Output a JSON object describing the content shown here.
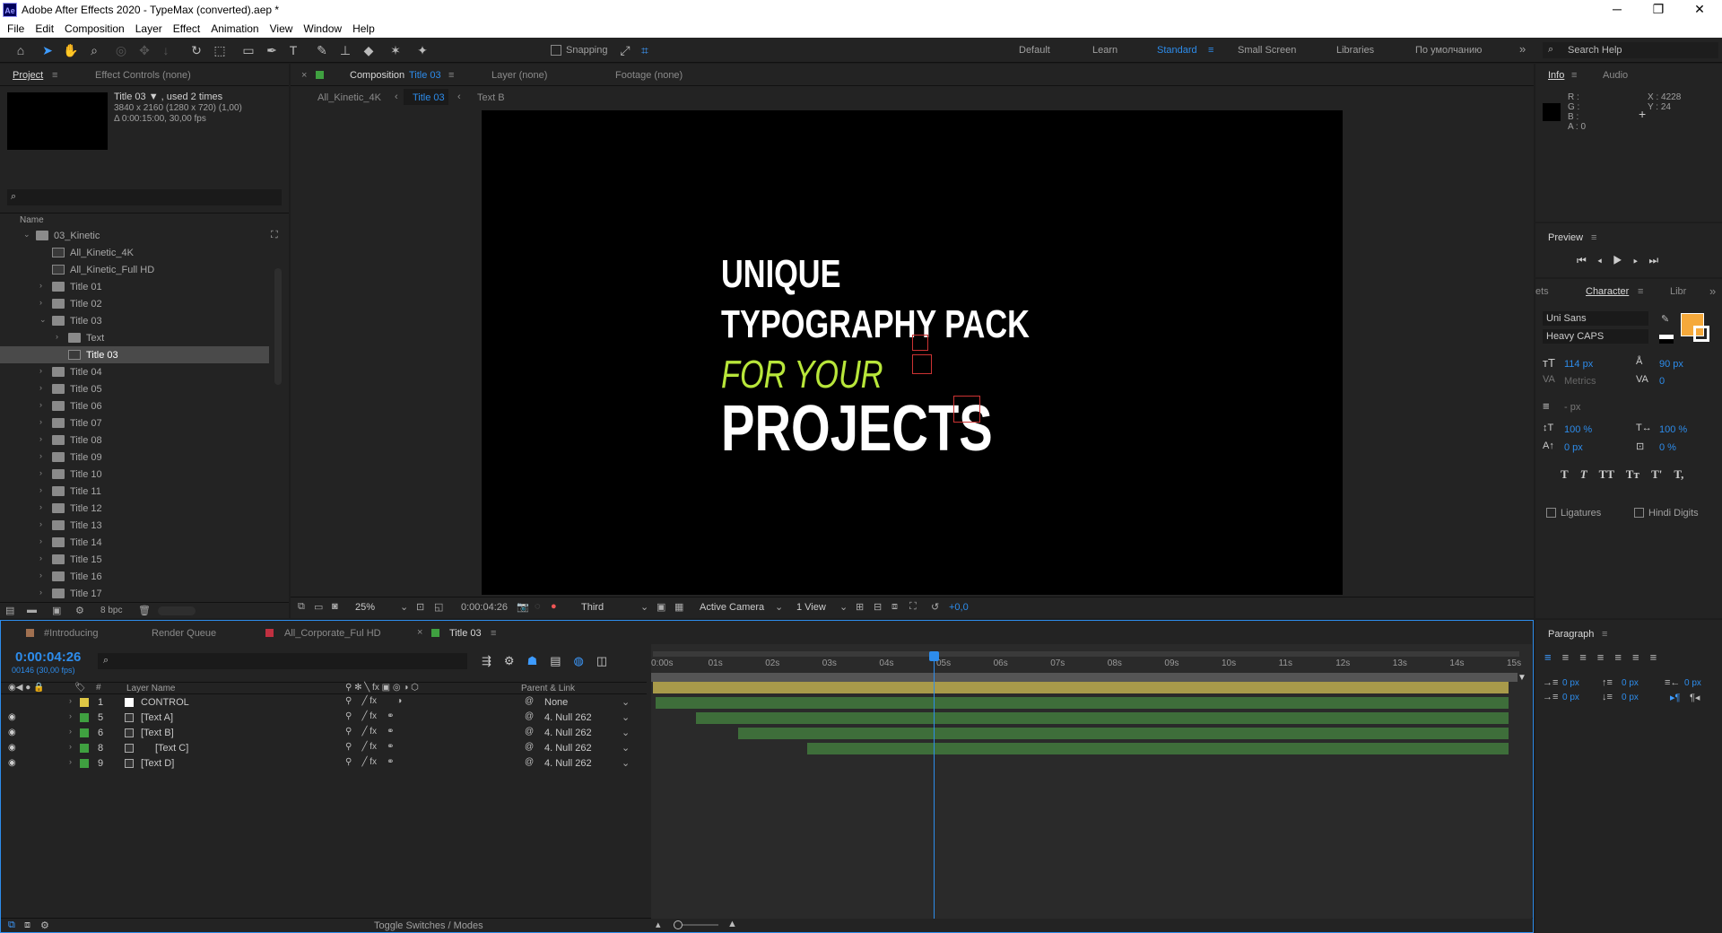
{
  "window": {
    "title": "Adobe After Effects 2020 - TypeMax (converted).aep *",
    "app_icon": "Ae",
    "min": "─",
    "max": "❐",
    "close": "✕"
  },
  "menu": [
    "File",
    "Edit",
    "Composition",
    "Layer",
    "Effect",
    "Animation",
    "View",
    "Window",
    "Help"
  ],
  "toolbar": {
    "snapping": "Snapping",
    "workspaces": [
      "Default",
      "Learn",
      "Standard",
      "Small Screen",
      "Libraries",
      "По умолчанию"
    ],
    "active_workspace": "Standard",
    "search_help": "Search Help"
  },
  "project": {
    "tab": "Project",
    "effect_controls": "Effect Controls (none)",
    "selected_name": "Title 03 ▼ , used 2 times",
    "selected_dims": "3840 x 2160  (1280 x 720) (1,00)",
    "selected_dur": "Δ 0:00:15:00, 30,00 fps",
    "search_icon": "⌕",
    "column_name": "Name",
    "bpc": "8 bpc",
    "items": [
      {
        "label": "03_Kinetic",
        "type": "folder",
        "indent": 0,
        "open": true
      },
      {
        "label": "All_Kinetic_4K",
        "type": "comp",
        "indent": 1
      },
      {
        "label": "All_Kinetic_Full HD",
        "type": "comp",
        "indent": 1
      },
      {
        "label": "Title 01",
        "type": "folder",
        "indent": 1
      },
      {
        "label": "Title 02",
        "type": "folder",
        "indent": 1
      },
      {
        "label": "Title 03",
        "type": "folder",
        "indent": 1,
        "open": true
      },
      {
        "label": "Text",
        "type": "folder",
        "indent": 2
      },
      {
        "label": "Title 03",
        "type": "comp",
        "indent": 2,
        "selected": true
      },
      {
        "label": "Title 04",
        "type": "folder",
        "indent": 1
      },
      {
        "label": "Title 05",
        "type": "folder",
        "indent": 1
      },
      {
        "label": "Title 06",
        "type": "folder",
        "indent": 1
      },
      {
        "label": "Title 07",
        "type": "folder",
        "indent": 1
      },
      {
        "label": "Title 08",
        "type": "folder",
        "indent": 1
      },
      {
        "label": "Title 09",
        "type": "folder",
        "indent": 1
      },
      {
        "label": "Title 10",
        "type": "folder",
        "indent": 1
      },
      {
        "label": "Title 11",
        "type": "folder",
        "indent": 1
      },
      {
        "label": "Title 12",
        "type": "folder",
        "indent": 1
      },
      {
        "label": "Title 13",
        "type": "folder",
        "indent": 1
      },
      {
        "label": "Title 14",
        "type": "folder",
        "indent": 1
      },
      {
        "label": "Title 15",
        "type": "folder",
        "indent": 1
      },
      {
        "label": "Title 16",
        "type": "folder",
        "indent": 1
      },
      {
        "label": "Title 17",
        "type": "folder",
        "indent": 1
      }
    ]
  },
  "viewer": {
    "comp_tab_prefix": "Composition",
    "comp_tab_name": "Title 03",
    "layer_tab": "Layer (none)",
    "footage_tab": "Footage (none)",
    "breadcrumbs": [
      "All_Kinetic_4K",
      "Title 03",
      "Text B"
    ],
    "text_lines": [
      "UNIQUE",
      "TYPOGRAPHY PACK",
      "FOR YOUR",
      "PROJECTS"
    ],
    "accent": "#b8e63a",
    "bottom": {
      "zoom": "25%",
      "timecode": "0:00:04:26",
      "resolution": "Third",
      "camera": "Active Camera",
      "views": "1 View",
      "exposure": "+0,0"
    }
  },
  "info": {
    "tab": "Info",
    "audio": "Audio",
    "r": "R :",
    "g": "G :",
    "b": "B :",
    "a": "A : 0",
    "x": "X : 4228",
    "y": "Y : 24"
  },
  "preview": {
    "title": "Preview"
  },
  "character": {
    "tab_left": "ets",
    "tab": "Character",
    "tab_right": "Libr",
    "font": "Uni Sans",
    "style": "Heavy CAPS",
    "size": "114 px",
    "leading": "90 px",
    "kerning": "Metrics",
    "tracking": "0",
    "stroke": "- px",
    "vscale": "100 %",
    "hscale": "100 %",
    "baseline": "0 px",
    "tsume": "0 %",
    "ligatures": "Ligatures",
    "hindi": "Hindi Digits",
    "fill_color": "#f5a93b",
    "styles": [
      "T",
      "T",
      "TT",
      "Tт",
      "T'",
      "T,"
    ]
  },
  "paragraph": {
    "title": "Paragraph",
    "vals": [
      "0 px",
      "0 px",
      "0 px",
      "0 px",
      "0 px"
    ]
  },
  "timeline": {
    "tabs": [
      "#Introducing",
      "Render Queue",
      "All_Corporate_Ful HD",
      "Title 03"
    ],
    "timecode": "0:00:04:26",
    "frames": "00146 (30,00 fps)",
    "col_name": "Layer Name",
    "col_parent": "Parent & Link",
    "toggle": "Toggle Switches / Modes",
    "ruler": [
      "0:00s",
      "01s",
      "02s",
      "03s",
      "04s",
      "05s",
      "06s",
      "07s",
      "08s",
      "09s",
      "10s",
      "11s",
      "12s",
      "13s",
      "14s",
      "15s"
    ],
    "layers": [
      {
        "num": "1",
        "name": "CONTROL",
        "color": "#e0c845",
        "parent": "None",
        "bar_color": "#a89a4a",
        "start": 0.0,
        "end": 1.0
      },
      {
        "num": "5",
        "name": "[Text A]",
        "color": "#3fa040",
        "parent": "4. Null 262",
        "bar_color": "#3e6e3a",
        "start": 0.003,
        "end": 1.0
      },
      {
        "num": "6",
        "name": "[Text B]",
        "color": "#3fa040",
        "parent": "4. Null 262",
        "bar_color": "#3e6e3a",
        "start": 0.05,
        "end": 1.0
      },
      {
        "num": "8",
        "name": "[Text C]",
        "color": "#3fa040",
        "parent": "4. Null 262",
        "bar_color": "#3e6e3a",
        "start": 0.1,
        "end": 1.0
      },
      {
        "num": "9",
        "name": "[Text D]",
        "color": "#3fa040",
        "parent": "4. Null 262",
        "bar_color": "#3e6e3a",
        "start": 0.18,
        "end": 1.0
      }
    ],
    "playhead": 0.3284
  }
}
